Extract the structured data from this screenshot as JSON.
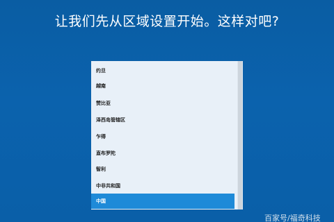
{
  "heading": "让我们先从区域设置开始。这样对吧?",
  "regions": [
    {
      "label": "约旦",
      "selected": false
    },
    {
      "label": "越南",
      "selected": false
    },
    {
      "label": "赞比亚",
      "selected": false
    },
    {
      "label": "泽西岛管辖区",
      "selected": false
    },
    {
      "label": "乍得",
      "selected": false
    },
    {
      "label": "直布罗陀",
      "selected": false
    },
    {
      "label": "智利",
      "selected": false
    },
    {
      "label": "中非共和国",
      "selected": false
    },
    {
      "label": "中国",
      "selected": true
    }
  ],
  "watermark": "百家号/福奇科技",
  "colors": {
    "background": "#0b62ad",
    "list_background": "#e8f0f8",
    "selected_background": "#1e8ad8"
  }
}
